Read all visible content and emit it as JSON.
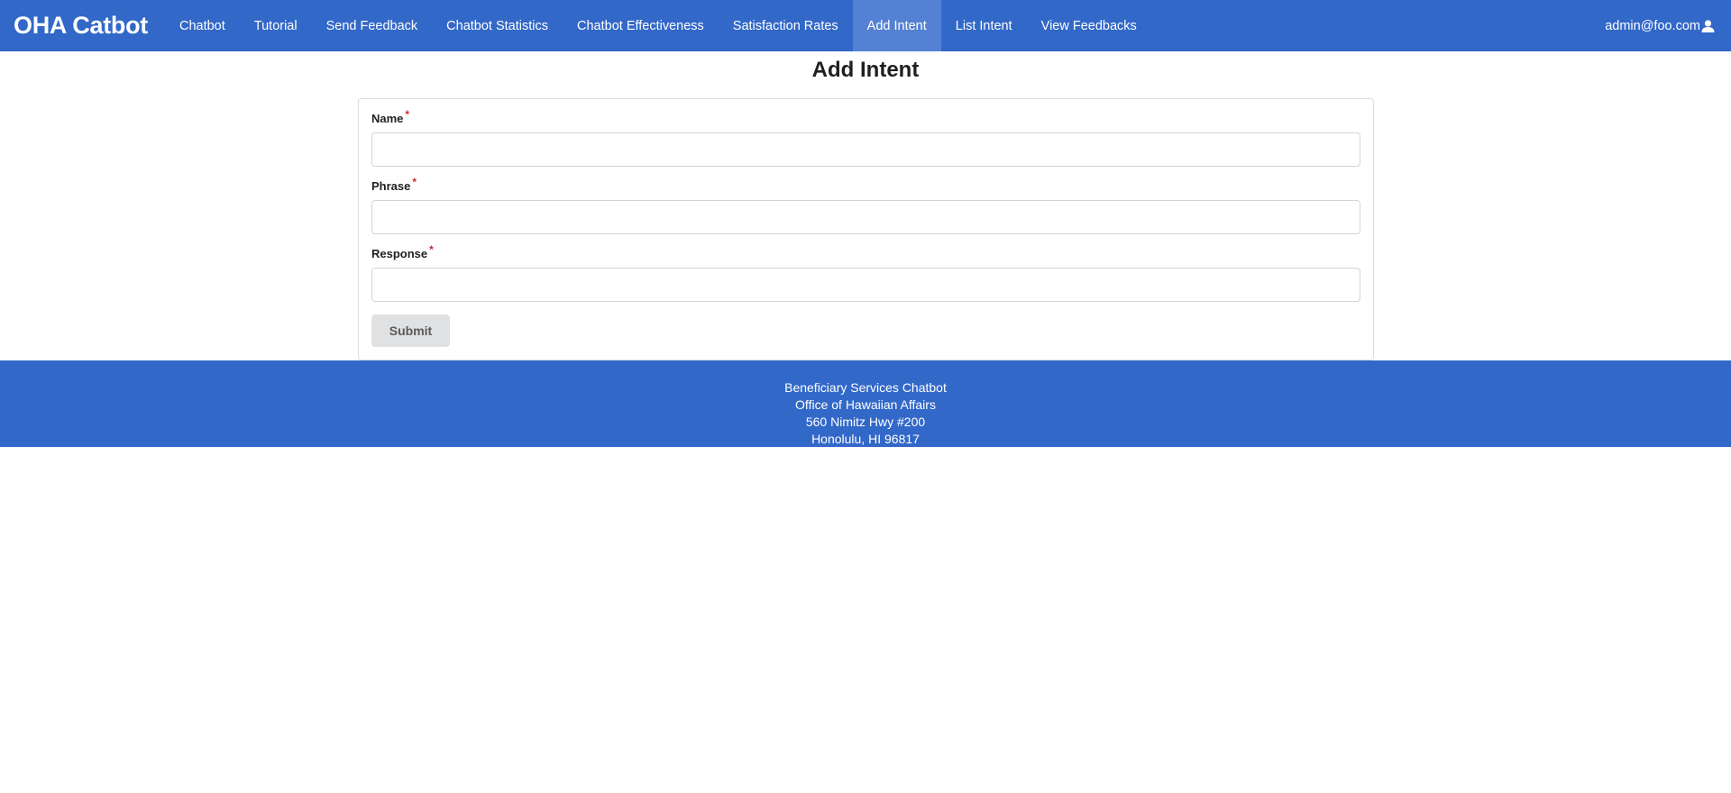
{
  "navbar": {
    "brand": "OHA Catbot",
    "items": [
      {
        "label": "Chatbot"
      },
      {
        "label": "Tutorial"
      },
      {
        "label": "Send Feedback"
      },
      {
        "label": "Chatbot Statistics"
      },
      {
        "label": "Chatbot Effectiveness"
      },
      {
        "label": "Satisfaction Rates"
      },
      {
        "label": "Add Intent",
        "active": true
      },
      {
        "label": "List Intent"
      },
      {
        "label": "View Feedbacks"
      }
    ],
    "user": "admin@foo.com",
    "user_icon": "user-icon"
  },
  "page": {
    "title": "Add Intent"
  },
  "form": {
    "fields": [
      {
        "label": "Name",
        "required_marker": "*",
        "value": "",
        "placeholder": ""
      },
      {
        "label": "Phrase",
        "required_marker": "*",
        "value": "",
        "placeholder": ""
      },
      {
        "label": "Response",
        "required_marker": "*",
        "value": "",
        "placeholder": ""
      }
    ],
    "submit_label": "Submit"
  },
  "footer": {
    "lines": [
      "Beneficiary Services Chatbot",
      "Office of Hawaiian Affairs",
      "560 Nimitz Hwy #200",
      "Honolulu, HI 96817"
    ]
  },
  "colors": {
    "primary": "#3268c8",
    "active_nav": "#5481d3",
    "required": "#d12a2a",
    "button_bg": "#e0e1e2"
  }
}
